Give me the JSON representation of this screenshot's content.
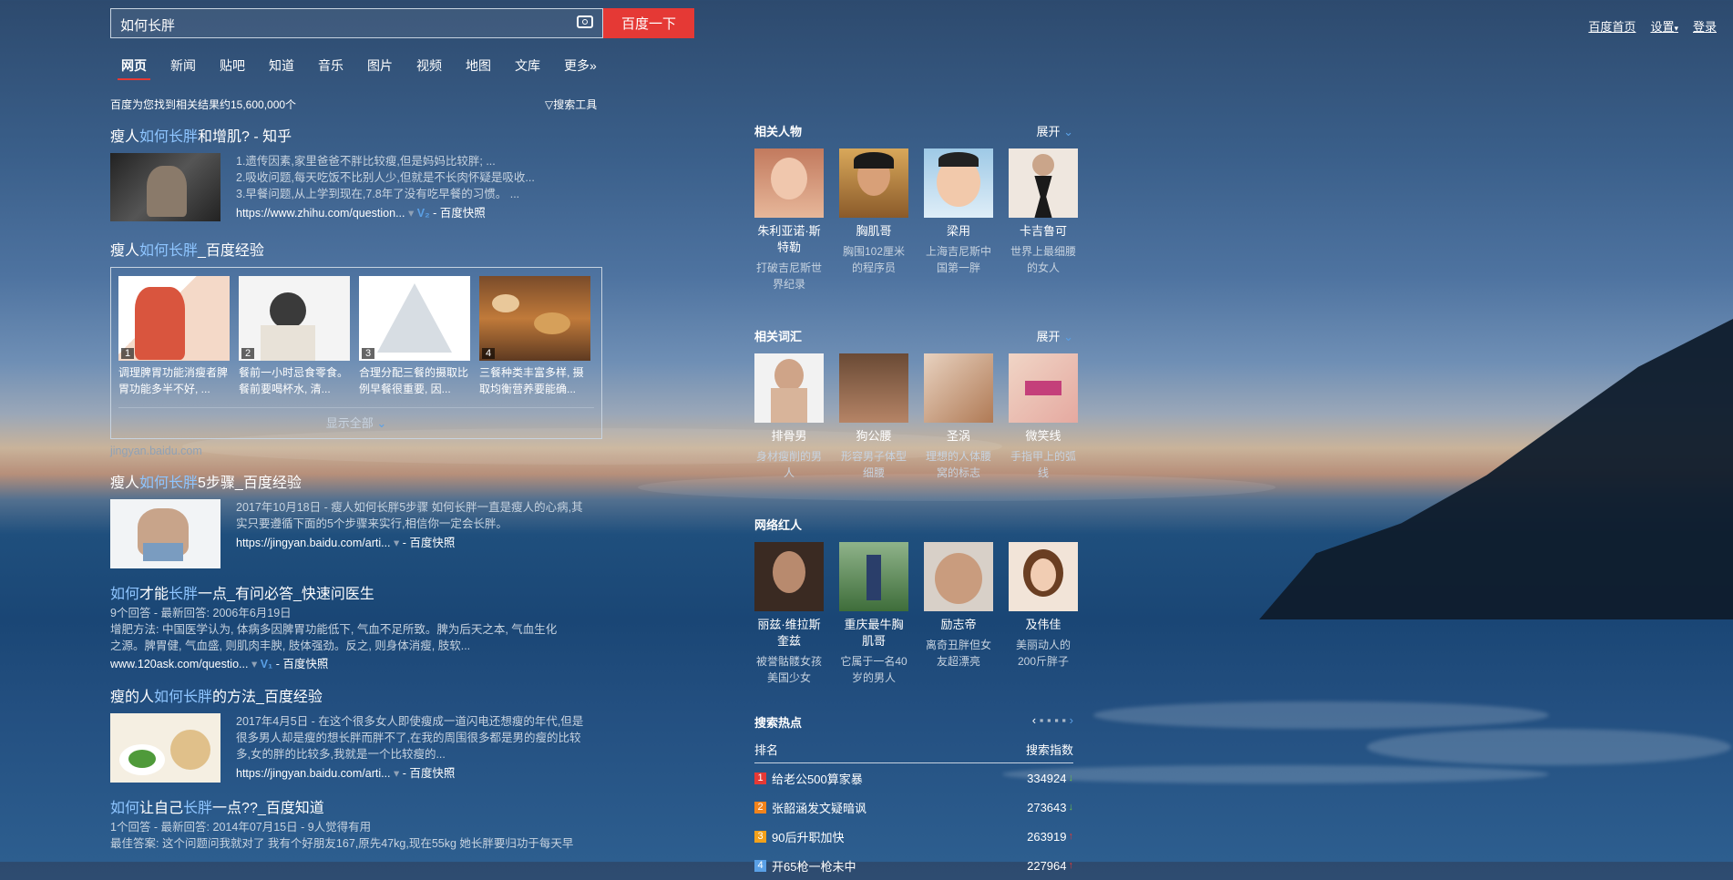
{
  "search": {
    "query": "如何长胖",
    "button_label": "百度一下"
  },
  "top_links": [
    "百度首页",
    "设置",
    "登录"
  ],
  "nav": {
    "tabs": [
      "网页",
      "新闻",
      "贴吧",
      "知道",
      "音乐",
      "图片",
      "视频",
      "地图",
      "文库",
      "更多»"
    ]
  },
  "result_count": "百度为您找到相关结果约15,600,000个",
  "search_tools": "搜索工具",
  "results": [
    {
      "title_pre": "瘦人",
      "title_kw": "如何长胖",
      "title_post": "和增肌? - 知乎",
      "lines": [
        "1.遗传因素,家里爸爸不胖比较瘦,但是妈妈比较胖; ...",
        "2.吸收问题,每天吃饭不比别人少,但就是不长肉怀疑是吸收...",
        "3.早餐问题,从上学到现在,7.8年了没有吃早餐的习惯。 ..."
      ],
      "url": "https://www.zhihu.com/question...",
      "badge": "V₂",
      "snapshot": "百度快照"
    },
    {
      "title_pre": "瘦人",
      "title_kw": "如何长胖",
      "title_post": "_百度经验",
      "items": [
        {
          "num": "1",
          "text": "调理脾胃功能消瘦者脾胃功能多半不好, ..."
        },
        {
          "num": "2",
          "text": "餐前一小时忌食零食。餐前要喝杯水, 清..."
        },
        {
          "num": "3",
          "text": "合理分配三餐的摄取比例早餐很重要, 因..."
        },
        {
          "num": "4",
          "text": "三餐种类丰富多样, 摄取均衡营养要能确..."
        }
      ],
      "show_all": "显示全部",
      "domain": "jingyan.baidu.com"
    },
    {
      "title_pre": "瘦人",
      "title_kw": "如何长胖",
      "title_post": "5步骤_百度经验",
      "line1": "2017年10月18日 - 瘦人如何长胖5步骤 如何长胖一直是瘦人的心病,其",
      "line2": "实只要遵循下面的5个步骤来实行,相信你一定会长胖。",
      "url": "https://jingyan.baidu.com/arti...",
      "snapshot": "百度快照"
    },
    {
      "title_kw1": "如何",
      "title_mid": "才能",
      "title_kw2": "长胖",
      "title_post": "一点_有问必答_快速问医生",
      "meta": "9个回答 - 最新回答: 2006年6月19日",
      "body1": "增肥方法: 中国医学认为, 体病多因脾胃功能低下, 气血不足所致。脾为后天之本, 气血生化",
      "body2": "之源。脾胃健, 气血盛, 则肌肉丰腴, 肢体强劲。反之, 则身体消瘦, 肢软...",
      "url": "www.120ask.com/questio...",
      "badge": "V₁",
      "snapshot": "百度快照"
    },
    {
      "title_pre": "瘦的人",
      "title_kw": "如何长胖",
      "title_post": "的方法_百度经验",
      "line1": "2017年4月5日 - 在这个很多女人即使瘦成一道闪电还想瘦的年代,但是",
      "line2": "很多男人却是瘦的想长胖而胖不了,在我的周围很多都是男的瘦的比较",
      "line3": "多,女的胖的比较多,我就是一个比较瘦的...",
      "url": "https://jingyan.baidu.com/arti...",
      "snapshot": "百度快照"
    },
    {
      "title_kw1": "如何",
      "title_mid": "让自己",
      "title_kw2": "长胖",
      "title_post": "一点??_百度知道",
      "meta": "1个回答 - 最新回答: 2014年07月15日 - 9人觉得有用",
      "body1": "最佳答案: 这个问题问我就对了 我有个好朋友167,原先47kg,现在55kg 她长胖要归功于每天早"
    }
  ],
  "right": {
    "expand_label": "展开",
    "people": {
      "title": "相关人物",
      "cards": [
        {
          "name": "朱利亚诺·斯特勒",
          "desc": "打破吉尼斯世界纪录"
        },
        {
          "name": "胸肌哥",
          "desc": "胸围102厘米的程序员"
        },
        {
          "name": "梁用",
          "desc": "上海吉尼斯中国第一胖"
        },
        {
          "name": "卡吉鲁可",
          "desc": "世界上最细腰的女人"
        }
      ]
    },
    "words": {
      "title": "相关词汇",
      "cards": [
        {
          "name": "排骨男",
          "desc": "身材瘦削的男人"
        },
        {
          "name": "狗公腰",
          "desc": "形容男子体型细腰"
        },
        {
          "name": "圣涡",
          "desc": "理想的人体腰窝的标志"
        },
        {
          "name": "微笑线",
          "desc": "手指甲上的弧线"
        }
      ]
    },
    "celebs": {
      "title": "网络红人",
      "cards": [
        {
          "name": "丽兹·维拉斯奎兹",
          "desc": "被誉骷髅女孩美国少女"
        },
        {
          "name": "重庆最牛胸肌哥",
          "desc": "它属于一名40岁的男人"
        },
        {
          "name": "励志帝",
          "desc": "离奇丑胖但女友超漂亮"
        },
        {
          "name": "及伟佳",
          "desc": "美丽动人的200斤胖子"
        }
      ]
    },
    "hot": {
      "title": "搜索热点",
      "col_rank": "排名",
      "col_index": "搜索指数",
      "rows": [
        {
          "rank": "1",
          "term": "给老公500算家暴",
          "index": "334924",
          "trend": "down",
          "color": "#e53935"
        },
        {
          "rank": "2",
          "term": "张韶涵发文疑暗讽",
          "index": "273643",
          "trend": "down",
          "color": "#f2831b"
        },
        {
          "rank": "3",
          "term": "90后升职加快",
          "index": "263919",
          "trend": "up",
          "color": "#f2a11b"
        },
        {
          "rank": "4",
          "term": "开65枪一枪未中",
          "index": "227964",
          "trend": "up",
          "color": "#5aa0e6"
        }
      ]
    }
  }
}
